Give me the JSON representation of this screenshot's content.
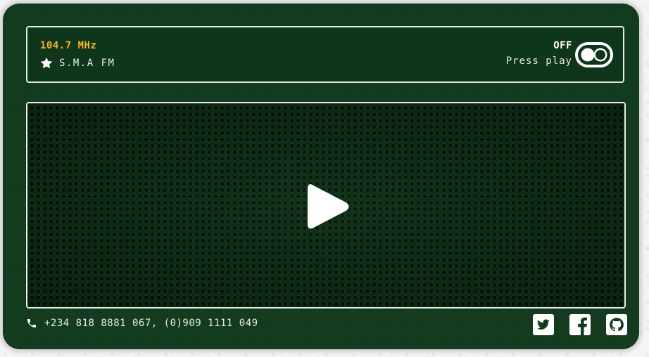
{
  "radio": {
    "frequency": "104.7 MHz",
    "station_name": "S.M.A FM",
    "power_state": "OFF",
    "hint": "Press play"
  },
  "footer": {
    "phone_numbers": "+234 818 8881 067, (0)909 1111 049",
    "socials": [
      "twitter-icon",
      "facebook-icon",
      "github-icon"
    ]
  },
  "colors": {
    "body": "#11391c",
    "frequency": "#f0b62a",
    "border": "#e6ece7",
    "text": "#e8ece8"
  }
}
